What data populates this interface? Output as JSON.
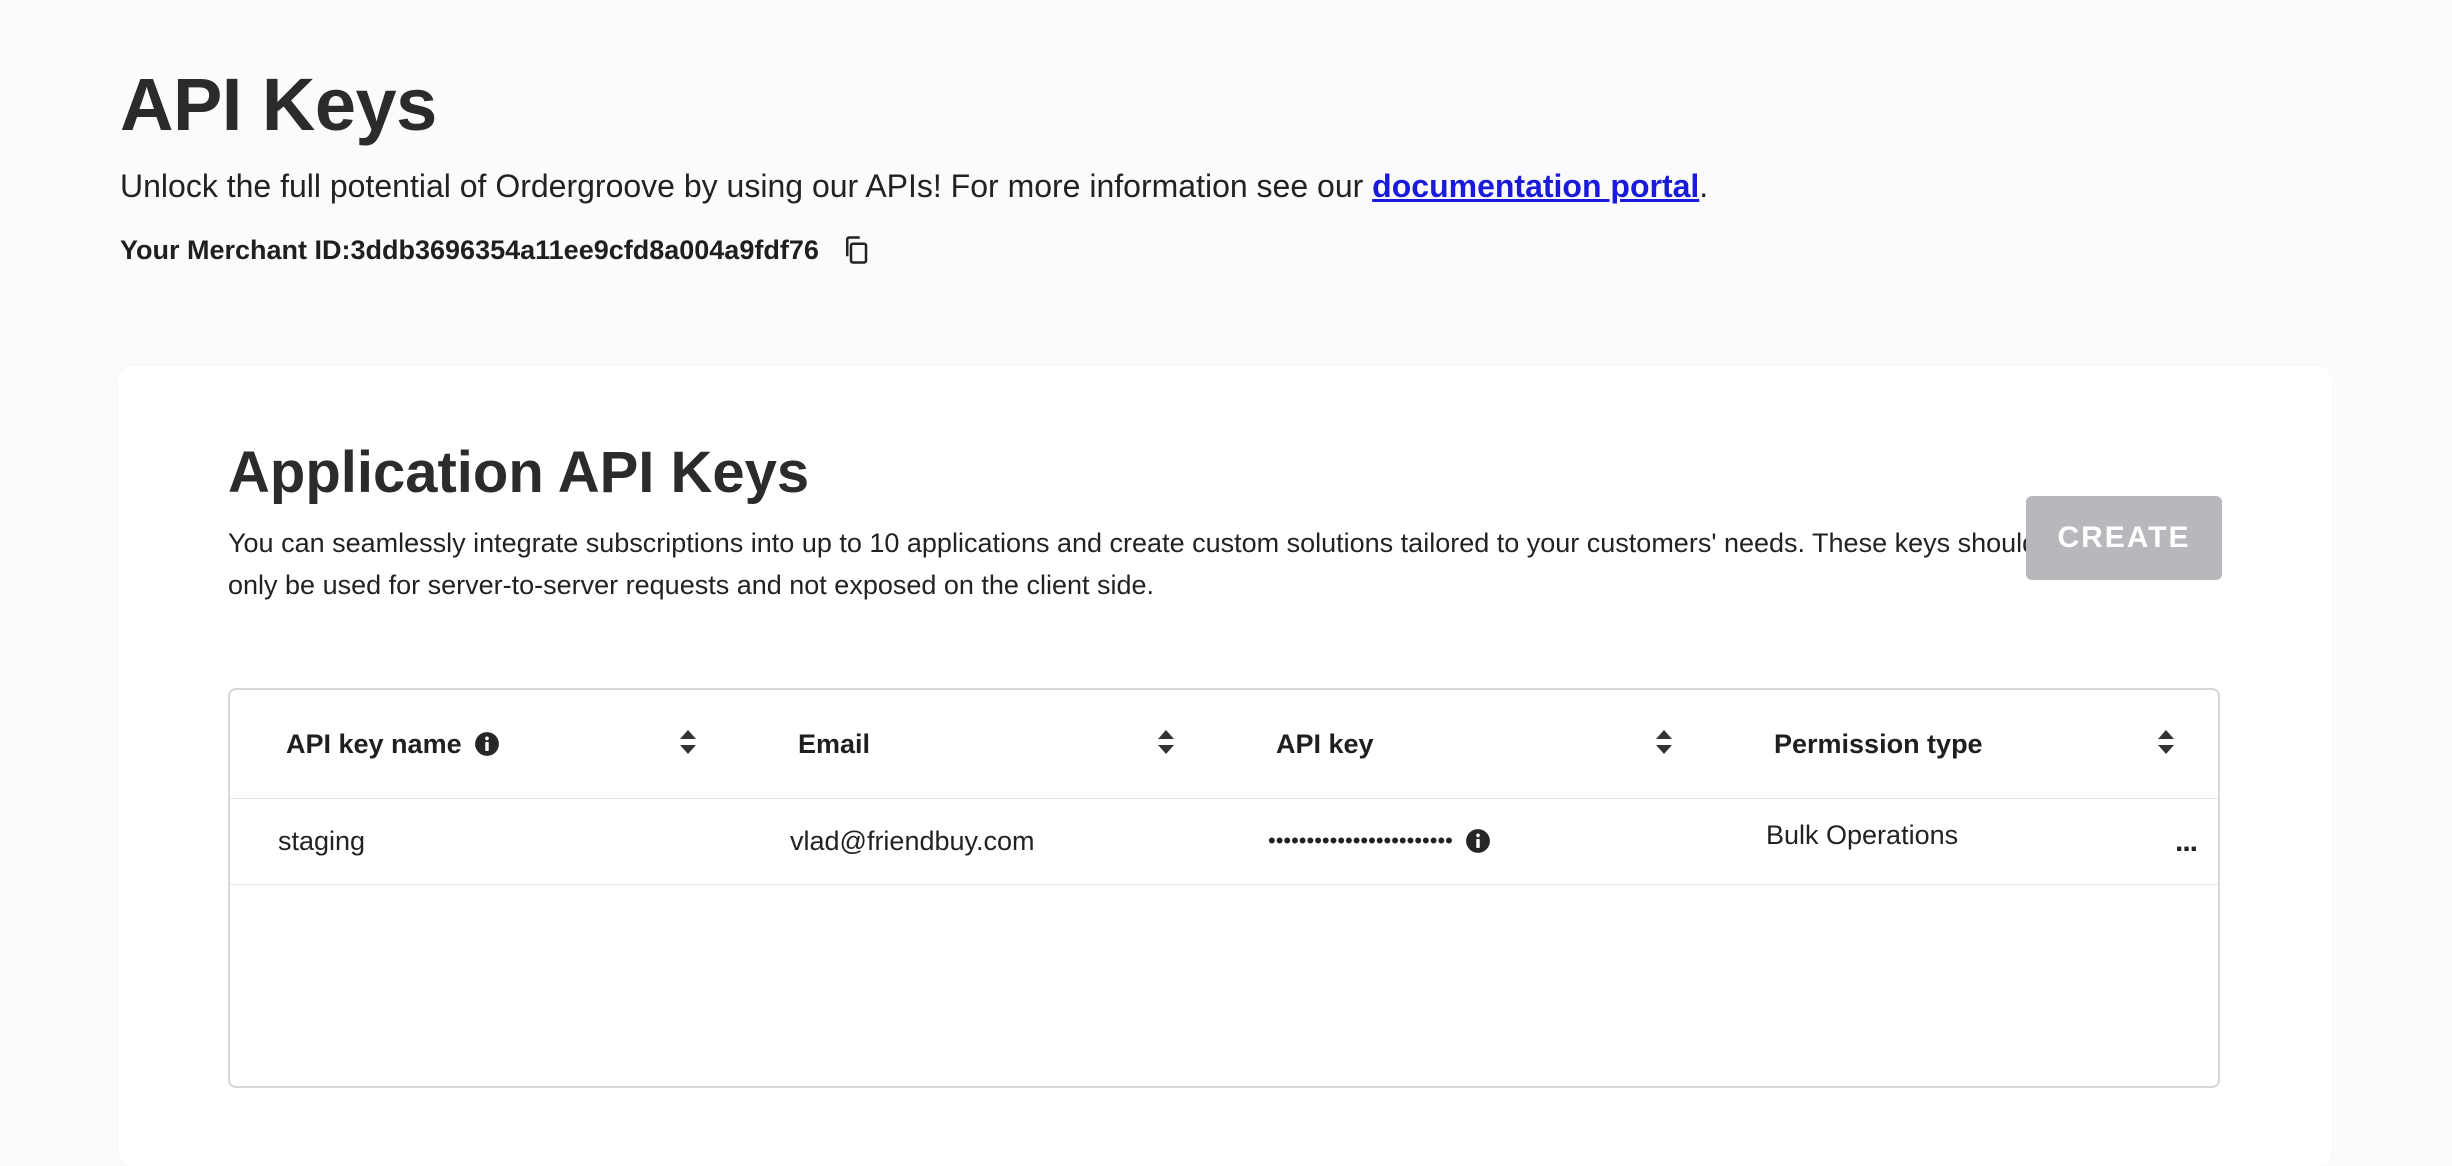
{
  "header": {
    "title": "API Keys",
    "intro_prefix": "Unlock the full potential of Ordergroove by using our APIs! For more information see our ",
    "doc_link": "documentation portal",
    "intro_suffix": ".",
    "merchant_label": "Your Merchant ID: ",
    "merchant_id": "3ddb3696354a11ee9cfd8a004a9fdf76"
  },
  "app_keys": {
    "title": "Application API Keys",
    "description": "You can seamlessly integrate subscriptions into up to 10 applications and create custom solutions tailored to your customers' needs. These keys should only be used for server-to-server requests and not exposed on the client side.",
    "create_label": "CREATE",
    "table": {
      "columns": [
        "API key name",
        "Email",
        "API key",
        "Permission type"
      ],
      "rows": [
        {
          "name": "staging",
          "email": "vlad@friendbuy.com",
          "key_masked": "••••••••••••••••••••••••",
          "permission": "Bulk Operations",
          "actions": "..."
        }
      ]
    }
  },
  "colors": {
    "page_bg": "#fbfbfe",
    "link": "#1a1adb",
    "button_disabled": "#b8b8bc"
  },
  "icons": [
    "copy-icon",
    "info-icon",
    "sort-icon",
    "more-icon"
  ]
}
